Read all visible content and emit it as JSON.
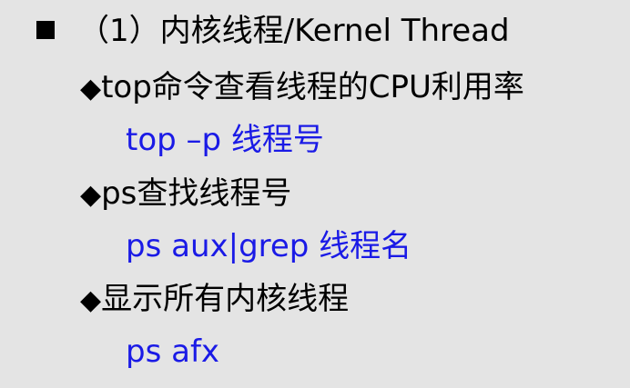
{
  "heading": {
    "text": "（1）内核线程/Kernel Thread"
  },
  "bullet_glyph": "◆",
  "items": [
    {
      "text": "top命令查看线程的CPU利用率",
      "command": "top –p  线程号"
    },
    {
      "text": "ps查找线程号",
      "command": "ps aux|grep  线程名"
    },
    {
      "text": "显示所有内核线程",
      "command": "ps afx"
    }
  ],
  "colors": {
    "background": "#e4e4e4",
    "text": "#000000",
    "command": "#1a1ae6"
  }
}
